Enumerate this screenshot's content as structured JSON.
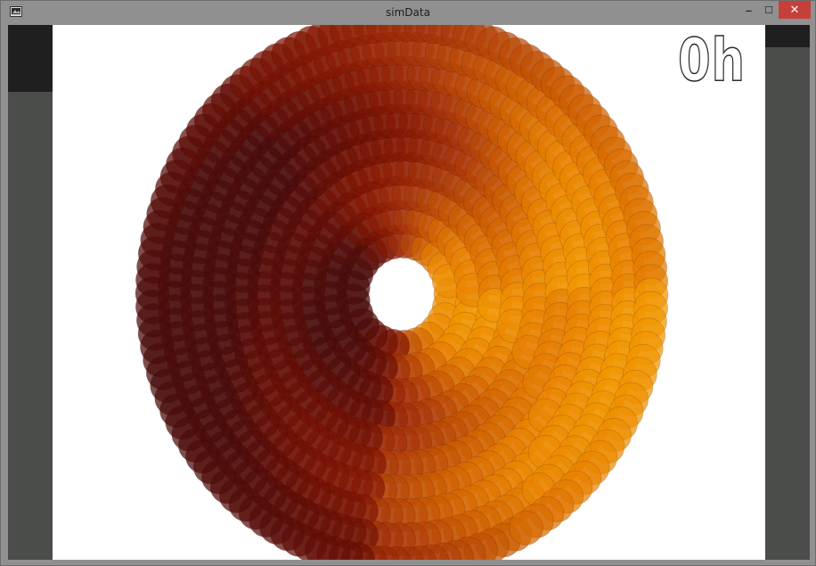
{
  "window": {
    "title": "simData",
    "minimize_glyph": "–",
    "maximize_glyph": "☐",
    "close_glyph": "✕"
  },
  "visualization": {
    "hour_label": "0h",
    "ring_colors": [
      "#4a0b0b",
      "#6b0f04",
      "#8a1a03",
      "#a8360a",
      "#c95a02",
      "#e88200",
      "#f39a00"
    ],
    "background": "#ffffff"
  }
}
